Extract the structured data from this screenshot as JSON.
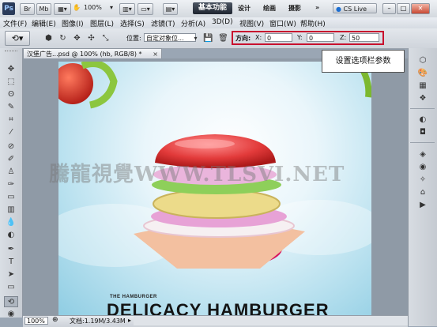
{
  "app": {
    "logo": "Ps"
  },
  "titlebar": {
    "chips": [
      "Br",
      "Mb"
    ],
    "zoom": "100%",
    "workspaces": {
      "active": "基本功能",
      "others": [
        "设计",
        "绘画",
        "摄影"
      ]
    },
    "more": "»",
    "cs_live": "CS Live"
  },
  "menu": [
    "文件(F)",
    "编辑(E)",
    "图像(I)",
    "图层(L)",
    "选择(S)",
    "滤镜(T)",
    "分析(A)",
    "3D(D)",
    "视图(V)",
    "窗口(W)",
    "帮助(H)"
  ],
  "options": {
    "position_label": "位置:",
    "position_value": "自定对象位...",
    "orientation_label": "方向:",
    "x_label": "X:",
    "x_value": "0",
    "y_label": "Y:",
    "y_value": "0",
    "z_label": "Z:",
    "z_value": "50"
  },
  "callout": "设置选项栏参数",
  "document": {
    "tab_title": "汉堡广告...psd @ 100% (hb, RGB/8) *",
    "tab_close": "×"
  },
  "artwork": {
    "tagline": "THE HAMBURGER",
    "headline": "DELICACY HAMBURGER",
    "watermark": "騰龍視覺WWW.TLSVI.NET"
  },
  "status": {
    "zoom": "100%",
    "doc_info": "文档:1.19M/3.43M"
  },
  "colors": {
    "highlight": "#c8102e",
    "accent": "#2a3b5a"
  }
}
